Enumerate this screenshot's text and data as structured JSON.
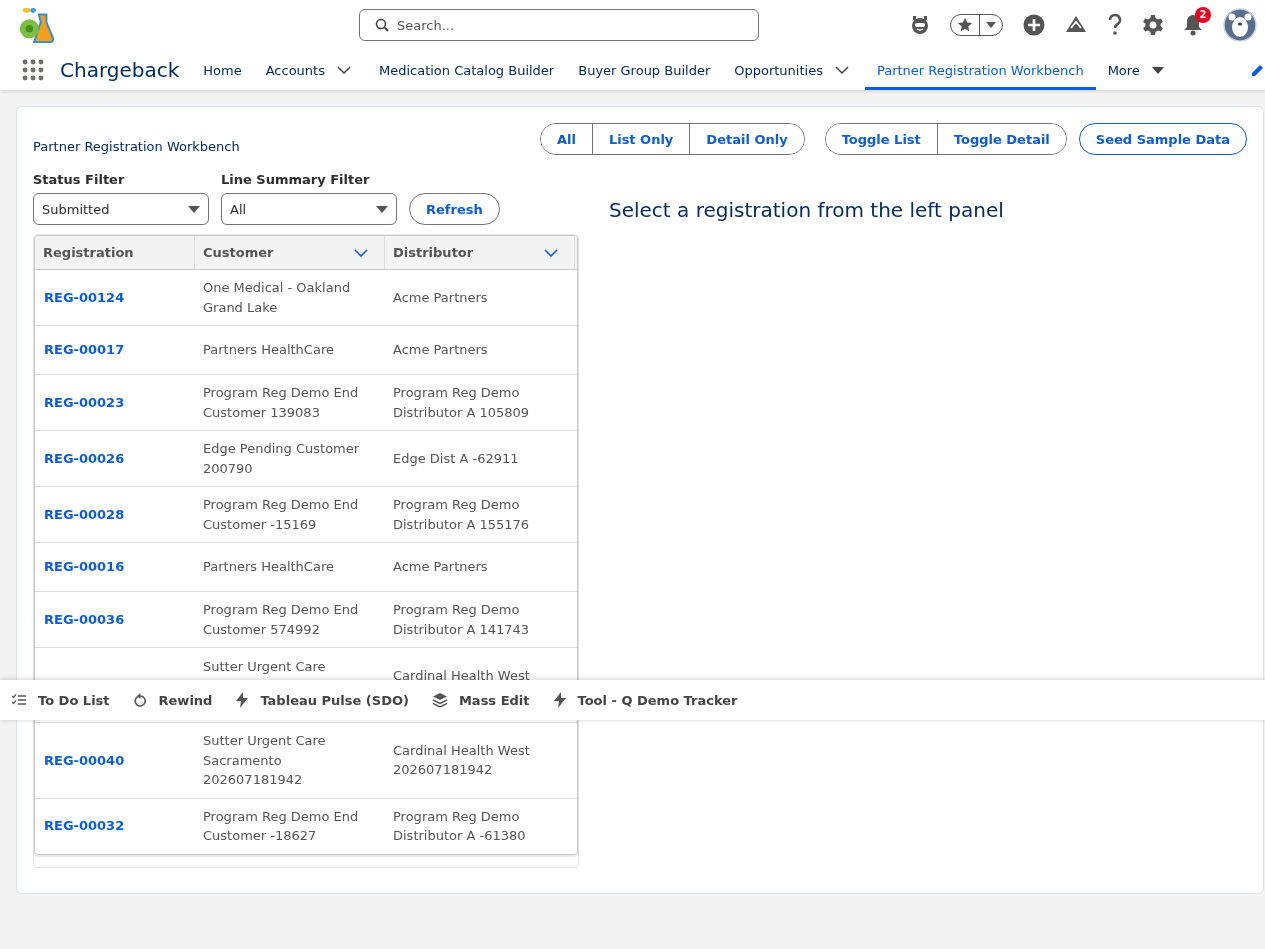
{
  "header": {
    "search": {
      "placeholder": "Search..."
    },
    "notifications": {
      "badge": "2"
    }
  },
  "nav": {
    "app_name": "Chargeback",
    "tabs": [
      {
        "label": "Home",
        "selected": false,
        "dropdown": false
      },
      {
        "label": "Accounts",
        "selected": false,
        "dropdown": true
      },
      {
        "label": "Medication Catalog Builder",
        "selected": false,
        "dropdown": false
      },
      {
        "label": "Buyer Group Builder",
        "selected": false,
        "dropdown": false
      },
      {
        "label": "Opportunities",
        "selected": false,
        "dropdown": true
      },
      {
        "label": "Partner Registration Workbench",
        "selected": true,
        "dropdown": false
      }
    ],
    "more": {
      "label": "More"
    }
  },
  "page": {
    "title": "Partner Registration Workbench",
    "view_buttons": [
      {
        "label": "All"
      },
      {
        "label": "List Only"
      },
      {
        "label": "Detail Only"
      }
    ],
    "toggle_buttons": [
      {
        "label": "Toggle List"
      },
      {
        "label": "Toggle Detail"
      }
    ],
    "seed_button": {
      "label": "Seed Sample Data"
    },
    "filters": [
      {
        "label": "Status Filter",
        "value": "Submitted"
      },
      {
        "label": "Line Summary Filter",
        "value": "All"
      }
    ],
    "refresh_button": {
      "label": "Refresh"
    },
    "table": {
      "columns": [
        {
          "label": "Registration",
          "menu": false
        },
        {
          "label": "Customer",
          "menu": true
        },
        {
          "label": "Distributor",
          "menu": true
        }
      ],
      "rows": [
        {
          "kind": "full",
          "registration": "REG-00124",
          "customer": "One Medical - Oakland Grand Lake",
          "distributor": "Acme Partners"
        },
        {
          "kind": "full",
          "registration": "REG-00017",
          "customer": "Partners HealthCare",
          "distributor": "Acme Partners"
        },
        {
          "kind": "full",
          "registration": "REG-00023",
          "customer": "Program Reg Demo End Customer 139083",
          "distributor": "Program Reg Demo Distributor A 105809"
        },
        {
          "kind": "full",
          "registration": "REG-00026",
          "customer": "Edge Pending Customer 200790",
          "distributor": "Edge Dist A -62911"
        },
        {
          "kind": "full",
          "registration": "REG-00028",
          "customer": "Program Reg Demo End Customer -15169",
          "distributor": "Program Reg Demo Distributor A 155176"
        },
        {
          "kind": "full",
          "registration": "REG-00016",
          "customer": "Partners HealthCare",
          "distributor": "Acme Partners"
        },
        {
          "kind": "full",
          "registration": "REG-00036",
          "customer": "Program Reg Demo End Customer 574992",
          "distributor": "Program Reg Demo Distributor A 141743"
        },
        {
          "kind": "covered",
          "customer": "Sutter Urgent Care",
          "distributor": "Cardinal Health West"
        },
        {
          "kind": "full",
          "registration": "REG-00040",
          "customer": "Sutter Urgent Care Sacramento 202607181942",
          "distributor": "Cardinal Health West 202607181942"
        },
        {
          "kind": "full",
          "registration": "REG-00032",
          "customer": "Program Reg Demo End Customer -18627",
          "distributor": "Program Reg Demo Distributor A -61380"
        }
      ]
    },
    "detail_message": "Select a registration from the left panel"
  },
  "utility_bar": [
    {
      "label": "To Do List",
      "kind": "checklist"
    },
    {
      "label": "Rewind",
      "kind": "rewind"
    },
    {
      "label": "Tableau Pulse (SDO)",
      "kind": "bolt"
    },
    {
      "label": "Mass Edit",
      "kind": "layers"
    },
    {
      "label": "Tool - Q Demo Tracker",
      "kind": "bolt"
    }
  ]
}
